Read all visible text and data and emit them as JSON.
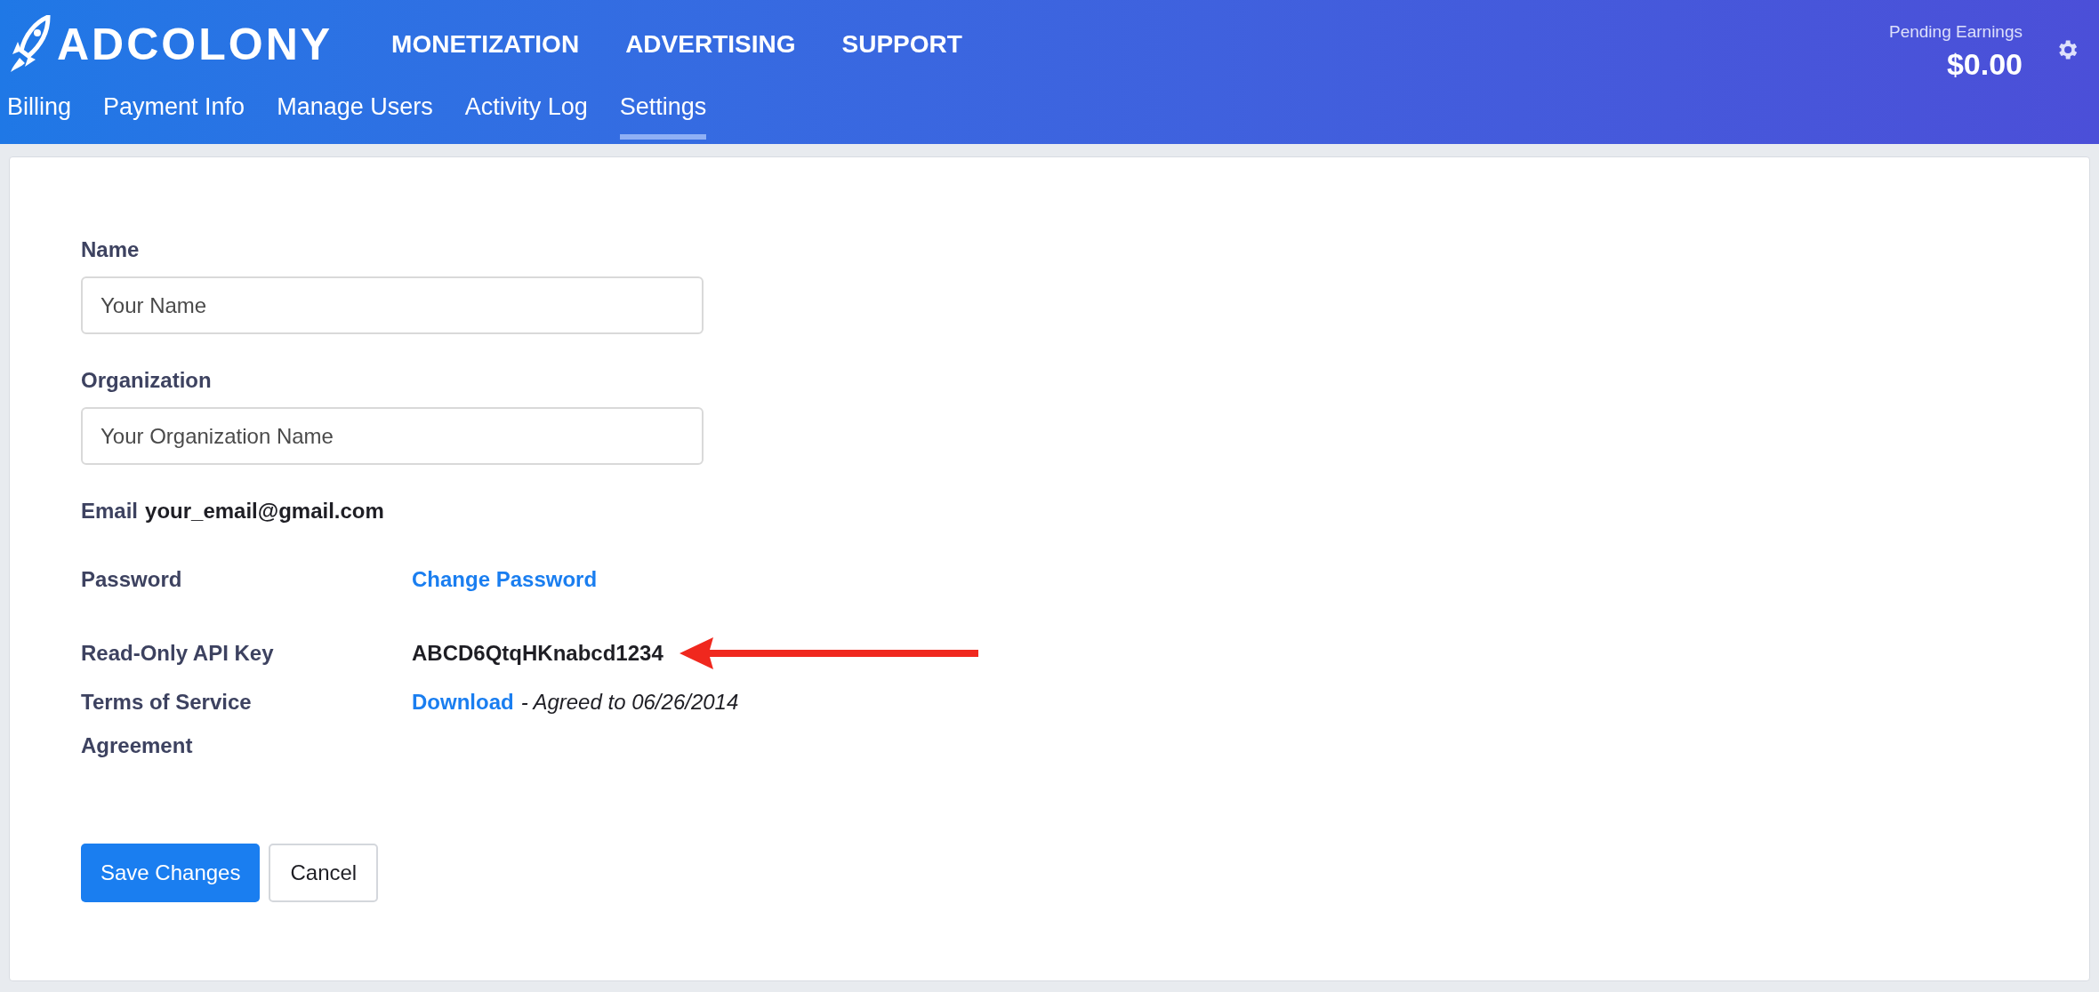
{
  "header": {
    "logo": "ADCOLONY",
    "main_nav": [
      {
        "label": "MONETIZATION",
        "selected": false
      },
      {
        "label": "ADVERTISING",
        "selected": false
      },
      {
        "label": "SUPPORT",
        "selected": false
      }
    ],
    "sub_nav": [
      {
        "label": "Billing",
        "selected": false
      },
      {
        "label": "Payment Info",
        "selected": false
      },
      {
        "label": "Manage Users",
        "selected": false
      },
      {
        "label": "Activity Log",
        "selected": false
      },
      {
        "label": "Settings",
        "selected": true
      }
    ],
    "earnings": {
      "label": "Pending Earnings",
      "amount": "$0.00"
    }
  },
  "form": {
    "fields": [
      {
        "label": "Name",
        "value": "Your Name"
      },
      {
        "label": "Organization",
        "value": "Your Organization Name"
      }
    ],
    "email": {
      "label": "Email",
      "value": "your_email@gmail.com"
    },
    "rows": [
      {
        "kind": "link",
        "label": "Password",
        "link": "Change Password"
      },
      {
        "kind": "key",
        "label": "Read-Only API Key",
        "value": "ABCD6QtqHKnabcd1234",
        "arrow": true
      },
      {
        "kind": "terms",
        "label": "Terms of Service Agreement",
        "link": "Download",
        "note": "- Agreed to 06/26/2014"
      }
    ],
    "buttons": [
      {
        "kind": "primary",
        "label": "Save Changes"
      },
      {
        "kind": "secondary",
        "label": "Cancel"
      }
    ]
  }
}
